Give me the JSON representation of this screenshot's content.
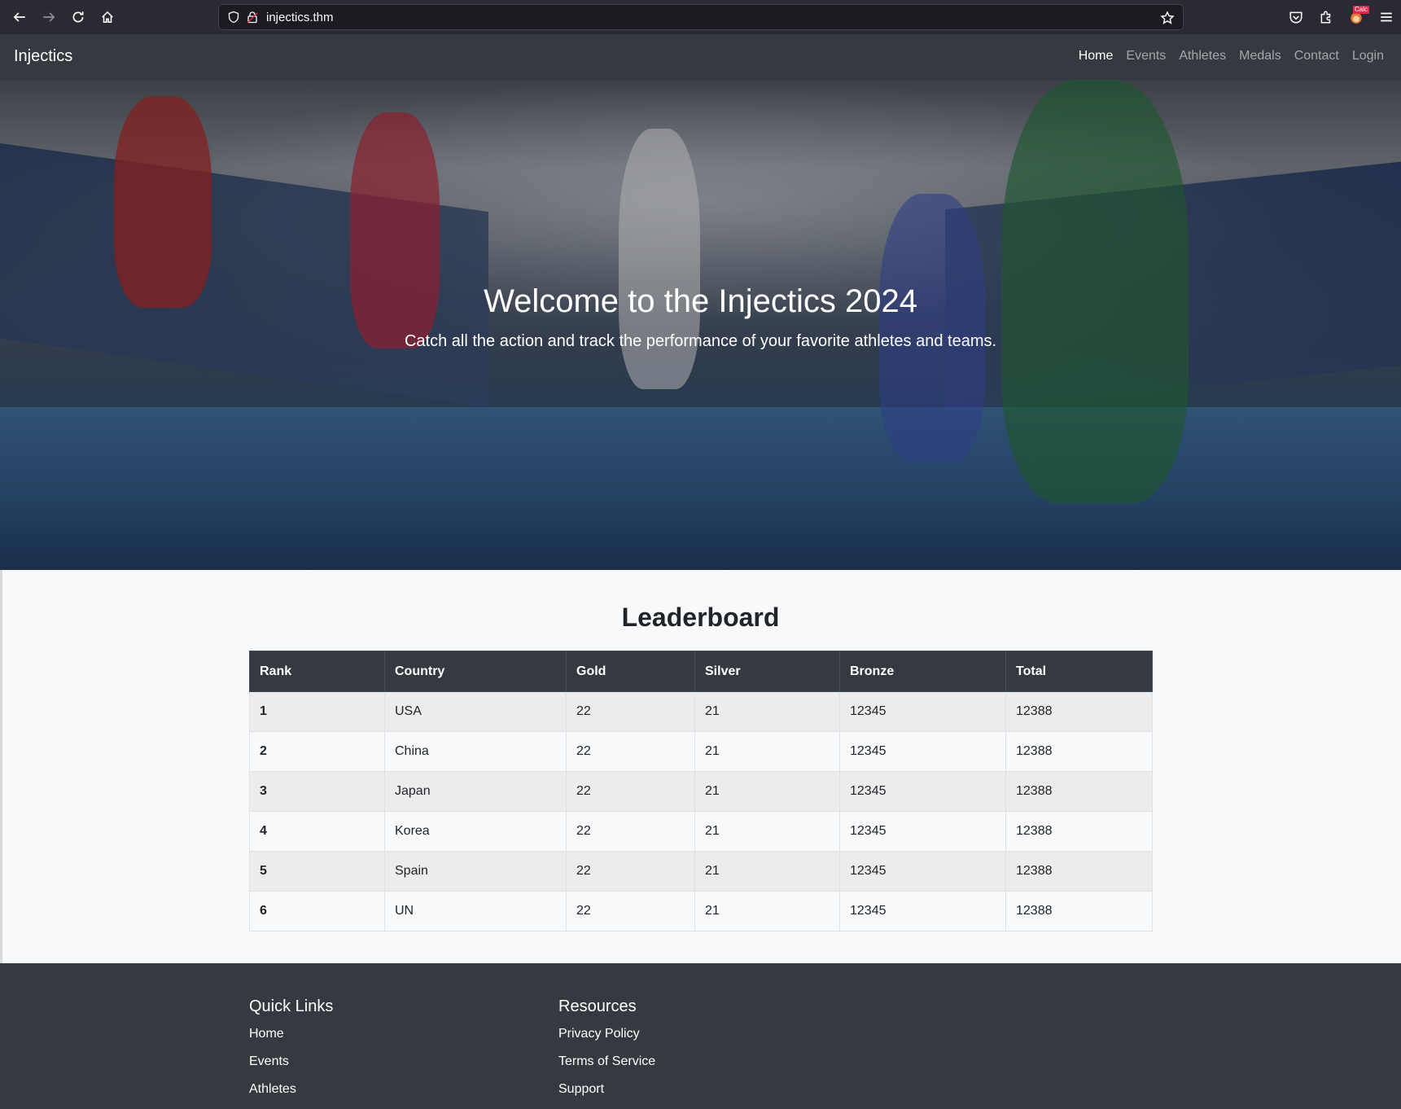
{
  "browser": {
    "url": "injectics.thm",
    "extension_badge": "Calc"
  },
  "navbar": {
    "brand": "Injectics",
    "links": [
      {
        "label": "Home",
        "active": true
      },
      {
        "label": "Events",
        "active": false
      },
      {
        "label": "Athletes",
        "active": false
      },
      {
        "label": "Medals",
        "active": false
      },
      {
        "label": "Contact",
        "active": false
      },
      {
        "label": "Login",
        "active": false
      }
    ]
  },
  "hero": {
    "title": "Welcome to the Injectics 2024",
    "subtitle": "Catch all the action and track the performance of your favorite athletes and teams."
  },
  "leaderboard": {
    "title": "Leaderboard",
    "columns": [
      "Rank",
      "Country",
      "Gold",
      "Silver",
      "Bronze",
      "Total"
    ],
    "rows": [
      [
        "1",
        "USA",
        "22",
        "21",
        "12345",
        "12388"
      ],
      [
        "2",
        "China",
        "22",
        "21",
        "12345",
        "12388"
      ],
      [
        "3",
        "Japan",
        "22",
        "21",
        "12345",
        "12388"
      ],
      [
        "4",
        "Korea",
        "22",
        "21",
        "12345",
        "12388"
      ],
      [
        "5",
        "Spain",
        "22",
        "21",
        "12345",
        "12388"
      ],
      [
        "6",
        "UN",
        "22",
        "21",
        "12345",
        "12388"
      ]
    ]
  },
  "footer": {
    "quick_links": {
      "title": "Quick Links",
      "items": [
        "Home",
        "Events",
        "Athletes"
      ]
    },
    "resources": {
      "title": "Resources",
      "items": [
        "Privacy Policy",
        "Terms of Service",
        "Support"
      ]
    }
  },
  "colors": {
    "navbar_bg": "#343a40",
    "browser_bg": "#2b2a33",
    "page_bg": "#f8f9fa"
  }
}
